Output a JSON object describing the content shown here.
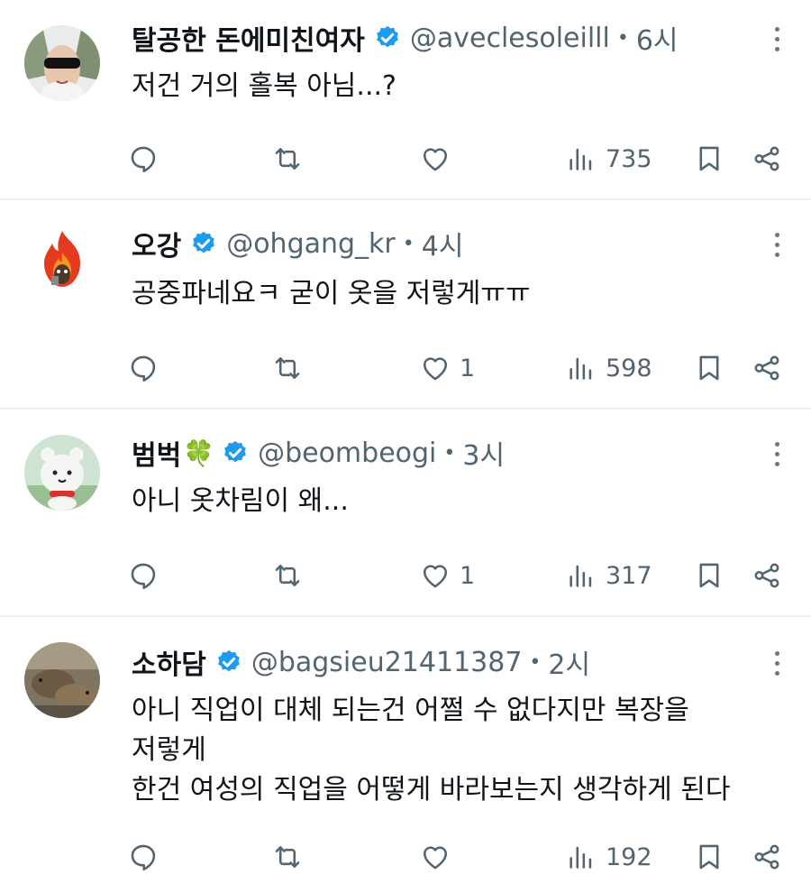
{
  "tweets": [
    {
      "name": "탈공한 돈에미친여자",
      "emoji": "",
      "handle": "@aveclesoleilll",
      "dot": "•",
      "time": "6시",
      "lines": [
        "저건 거의 홀복 아님...?"
      ],
      "replies": "",
      "retweets": "",
      "likes": "",
      "views": "735",
      "avatar_icon": "person-with-money-avatar"
    },
    {
      "name": "오강",
      "emoji": "",
      "handle": "@ohgang_kr",
      "dot": "•",
      "time": "4시",
      "lines": [
        "공중파네요ㅋ 굳이 옷을 저렇게ㅠㅠ"
      ],
      "replies": "",
      "retweets": "",
      "likes": "1",
      "views": "598",
      "avatar_icon": "fire-character-avatar"
    },
    {
      "name": "범벅",
      "emoji": "🍀",
      "handle": "@beombeogi",
      "dot": "•",
      "time": "3시",
      "lines": [
        "아니 옷차림이 왜..."
      ],
      "replies": "",
      "retweets": "",
      "likes": "1",
      "views": "317",
      "avatar_icon": "white-bear-avatar"
    },
    {
      "name": "소하담",
      "emoji": "",
      "handle": "@bagsieu21411387",
      "dot": "•",
      "time": "2시",
      "lines": [
        "아니 직업이 대체 되는건 어쩔 수 없다지만 복장을",
        "저렇게",
        "한건 여성의 직업을 어떻게 바라보는지 생각하게 된다"
      ],
      "replies": "",
      "retweets": "",
      "likes": "",
      "views": "192",
      "avatar_icon": "capybara-photo-avatar"
    }
  ],
  "colors": {
    "verified": "#1d9bf0",
    "meta": "#536471",
    "text": "#0f1419",
    "divider": "#eceff1"
  }
}
